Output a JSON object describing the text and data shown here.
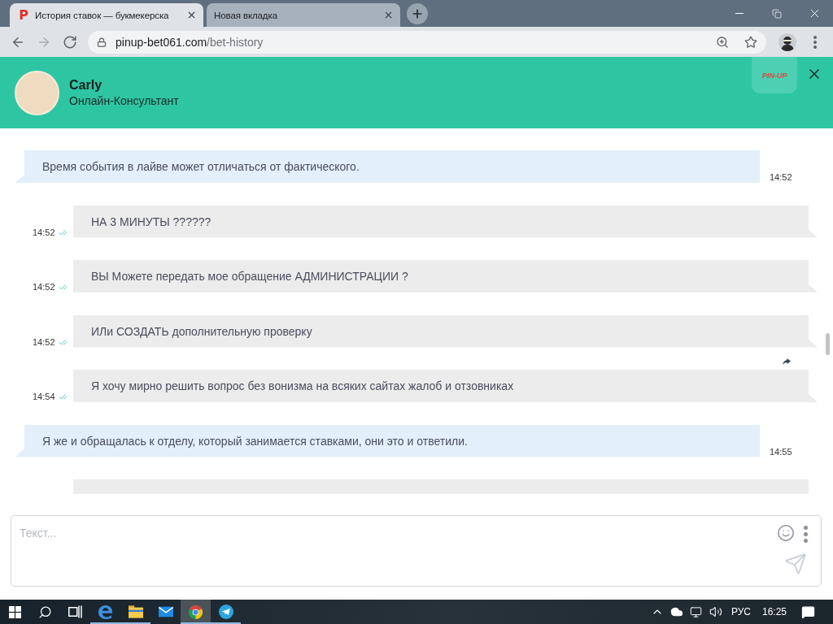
{
  "browser": {
    "tabs": [
      {
        "icon_letter": "P",
        "title": "История ставок — букмекерска",
        "selected": true
      },
      {
        "title": "Новая вкладка",
        "selected": false
      }
    ],
    "nav": [
      {
        "kind": "back",
        "disabled": false
      },
      {
        "kind": "forward",
        "disabled": true
      },
      {
        "kind": "reload",
        "disabled": false
      }
    ],
    "address": {
      "domain": "pinup-bet061.com",
      "path": "/bet-history"
    }
  },
  "chat": {
    "header": {
      "name": "Carly",
      "role": "Онлайн-Консультант",
      "logo": "PIN-UP"
    },
    "messages": [
      {
        "kind": "incoming",
        "text": "Время события в лайве может отличаться от фактического.",
        "time": "14:52"
      },
      {
        "kind": "outgoing",
        "text": "НА 3 МИНУТЫ ??????",
        "time": "14:52",
        "read": true,
        "forward_icon": false
      },
      {
        "kind": "outgoing",
        "text": "ВЫ Можете передать мое обращение АДМИНИСТРАЦИИ ?",
        "time": "14:52",
        "read": true,
        "forward_icon": false
      },
      {
        "kind": "outgoing",
        "text": "ИЛи СОЗДАТЬ дополнительную проверку",
        "time": "14:52",
        "read": true,
        "forward_icon": false
      },
      {
        "kind": "outgoing",
        "text": "Я хочу мирно решить вопрос без вонизма на всяких сайтах жалоб и отзовниках",
        "time": "14:54",
        "read": true,
        "forward_icon": true
      },
      {
        "kind": "incoming",
        "text": "Я же и обращалась к отделу, который занимается ставками, они это и ответили.",
        "time": "14:55"
      },
      {
        "kind": "outgoing"
      }
    ],
    "composer": {
      "placeholder": "Текст..."
    }
  },
  "taskbar": {
    "apps": [
      {
        "kind": "edge",
        "running": true,
        "selected": false
      },
      {
        "kind": "explorer",
        "running": true,
        "selected": false
      },
      {
        "kind": "mail",
        "running": false,
        "selected": false
      },
      {
        "kind": "chrome",
        "running": true,
        "selected": true
      },
      {
        "kind": "telegram",
        "running": true,
        "selected": false
      }
    ],
    "language": "РУС",
    "time": "16:25"
  }
}
